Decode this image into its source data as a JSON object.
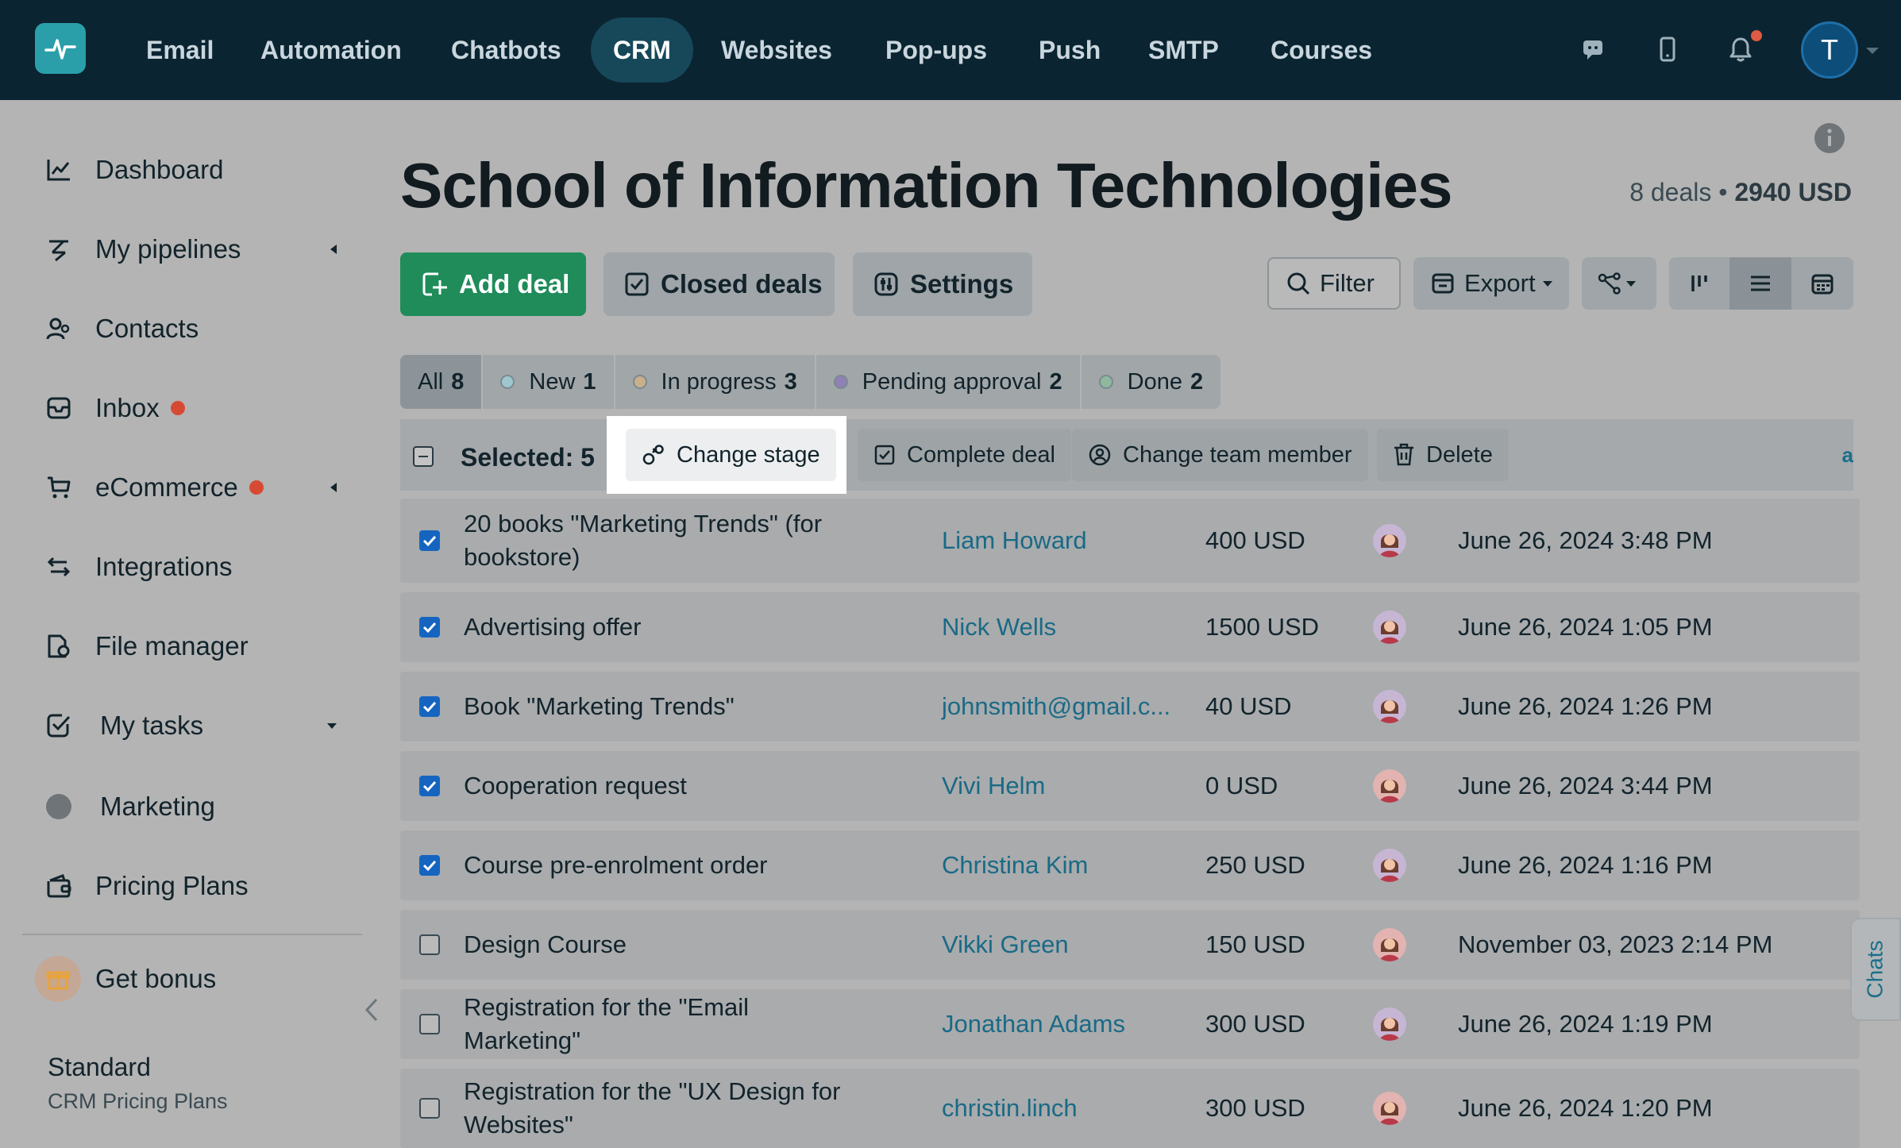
{
  "nav": {
    "items": [
      {
        "label": "Email",
        "active": false
      },
      {
        "label": "Automation",
        "active": false
      },
      {
        "label": "Chatbots",
        "active": false
      },
      {
        "label": "CRM",
        "active": true
      },
      {
        "label": "Websites",
        "active": false
      },
      {
        "label": "Pop-ups",
        "active": false
      },
      {
        "label": "Push",
        "active": false
      },
      {
        "label": "SMTP",
        "active": false
      },
      {
        "label": "Courses",
        "active": false
      }
    ],
    "avatar_letter": "T",
    "icons": [
      "chat-icon",
      "mobile-icon",
      "bell-icon"
    ]
  },
  "sidebar": {
    "items": [
      {
        "label": "Dashboard",
        "icon": "chart-line-icon"
      },
      {
        "label": "My pipelines",
        "icon": "pipeline-icon"
      },
      {
        "label": "Contacts",
        "icon": "contacts-icon"
      },
      {
        "label": "Inbox",
        "icon": "inbox-icon"
      },
      {
        "label": "eCommerce",
        "icon": "cart-icon"
      },
      {
        "label": "Integrations",
        "icon": "arrows-icon"
      },
      {
        "label": "File manager",
        "icon": "file-icon"
      },
      {
        "label": "My tasks",
        "icon": "tasks-icon"
      },
      {
        "label": "Marketing",
        "icon": "dot-icon"
      },
      {
        "label": "Pricing Plans",
        "icon": "wallet-icon"
      }
    ],
    "bonus_label": "Get bonus",
    "plan_name": "Standard",
    "plan_subtitle": "CRM Pricing Plans"
  },
  "header": {
    "title": "School of Information Technologies",
    "deals_count": "8 deals",
    "separator": "•",
    "total": "2940 USD"
  },
  "actions": {
    "add_deal": "Add deal",
    "closed_deals": "Closed deals",
    "settings": "Settings",
    "filter": "Filter",
    "export": "Export"
  },
  "stages": [
    {
      "label": "All",
      "count": "8",
      "color": ""
    },
    {
      "label": "New",
      "count": "1",
      "color": "#9ec7d0"
    },
    {
      "label": "In progress",
      "count": "3",
      "color": "#c9b08a"
    },
    {
      "label": "Pending approval",
      "count": "2",
      "color": "#8f80b6"
    },
    {
      "label": "Done",
      "count": "2",
      "color": "#8fb89f"
    }
  ],
  "bulk": {
    "selected_label": "Selected: 5",
    "change_stage": "Change stage",
    "complete_deal": "Complete deal",
    "change_team_member": "Change team member",
    "delete": "Delete",
    "more": "a"
  },
  "deals": [
    {
      "title": "20 books \"Marketing Trends\" (for bookstore)",
      "contact": "Liam Howard",
      "amount": "400 USD",
      "date": "June 26, 2024 3:48 PM",
      "checked": true
    },
    {
      "title": "Advertising offer",
      "contact": "Nick Wells",
      "amount": "1500 USD",
      "date": "June 26, 2024 1:05 PM",
      "checked": true
    },
    {
      "title": "Book \"Marketing Trends\"",
      "contact": "johnsmith@gmail.c...",
      "amount": "40 USD",
      "date": "June 26, 2024 1:26 PM",
      "checked": true
    },
    {
      "title": "Cooperation request",
      "contact": "Vivi Helm",
      "amount": "0 USD",
      "date": "June 26, 2024 3:44 PM",
      "checked": true
    },
    {
      "title": "Course pre-enrolment order",
      "contact": "Christina Kim",
      "amount": "250 USD",
      "date": "June 26, 2024 1:16 PM",
      "checked": true
    },
    {
      "title": "Design Course",
      "contact": "Vikki Green",
      "amount": "150 USD",
      "date": "November 03, 2023 2:14 PM",
      "checked": false
    },
    {
      "title": "Registration for the \"Email Marketing\"",
      "contact": "Jonathan Adams",
      "amount": "300 USD",
      "date": "June 26, 2024 1:19 PM",
      "checked": false
    },
    {
      "title": "Registration for the \"UX Design for Websites\"",
      "contact": "christin.linch",
      "amount": "300 USD",
      "date": "June 26, 2024 1:20 PM",
      "checked": false
    }
  ],
  "chats_tab": "Chats",
  "colors": {
    "accent": "#1f8c5a",
    "nav_bg": "#0b2431",
    "link": "#1a6a86",
    "checkbox": "#1565c0"
  }
}
